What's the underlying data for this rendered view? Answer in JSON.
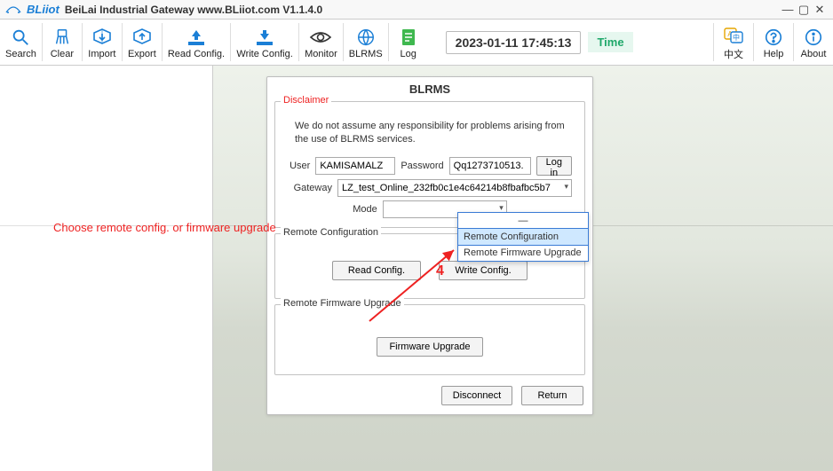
{
  "titlebar": {
    "brand": "BLiiot",
    "title": "BeiLai Industrial Gateway www.BLiiot.com V1.1.4.0"
  },
  "toolbar": {
    "search": "Search",
    "clear": "Clear",
    "import": "Import",
    "export": "Export",
    "read_config": "Read Config.",
    "write_config": "Write Config.",
    "monitor": "Monitor",
    "blrms": "BLRMS",
    "log": "Log",
    "timestamp": "2023-01-11 17:45:13",
    "time_btn": "Time",
    "lang": "中文",
    "help": "Help",
    "about": "About"
  },
  "dialog": {
    "title": "BLRMS",
    "disclaimer_legend": "Disclaimer",
    "disclaimer_text": "We do not assume any responsibility for problems arising from the use of BLRMS services.",
    "user_label": "User",
    "user_value": "KAMISAMALZ",
    "password_label": "Password",
    "password_value": "Qq1273710513.",
    "login_btn": "Log in",
    "gateway_label": "Gateway",
    "gateway_value": "LZ_test_Online_232fb0c1e4c64214b8fbafbc5b7",
    "mode_label": "Mode",
    "mode_value": "",
    "dropdown": {
      "dash": "—",
      "opt1": "Remote Configuration",
      "opt2": "Remote Firmware Upgrade"
    },
    "remote_config_legend": "Remote Configuration",
    "read_config_btn": "Read Config.",
    "write_config_btn": "Write Config.",
    "remote_fw_legend": "Remote Firmware Upgrade",
    "fw_upgrade_btn": "Firmware Upgrade",
    "disconnect_btn": "Disconnect",
    "return_btn": "Return"
  },
  "annotations": {
    "instruction": "Choose remote config. or firmware upgrade",
    "step_number": "4"
  }
}
